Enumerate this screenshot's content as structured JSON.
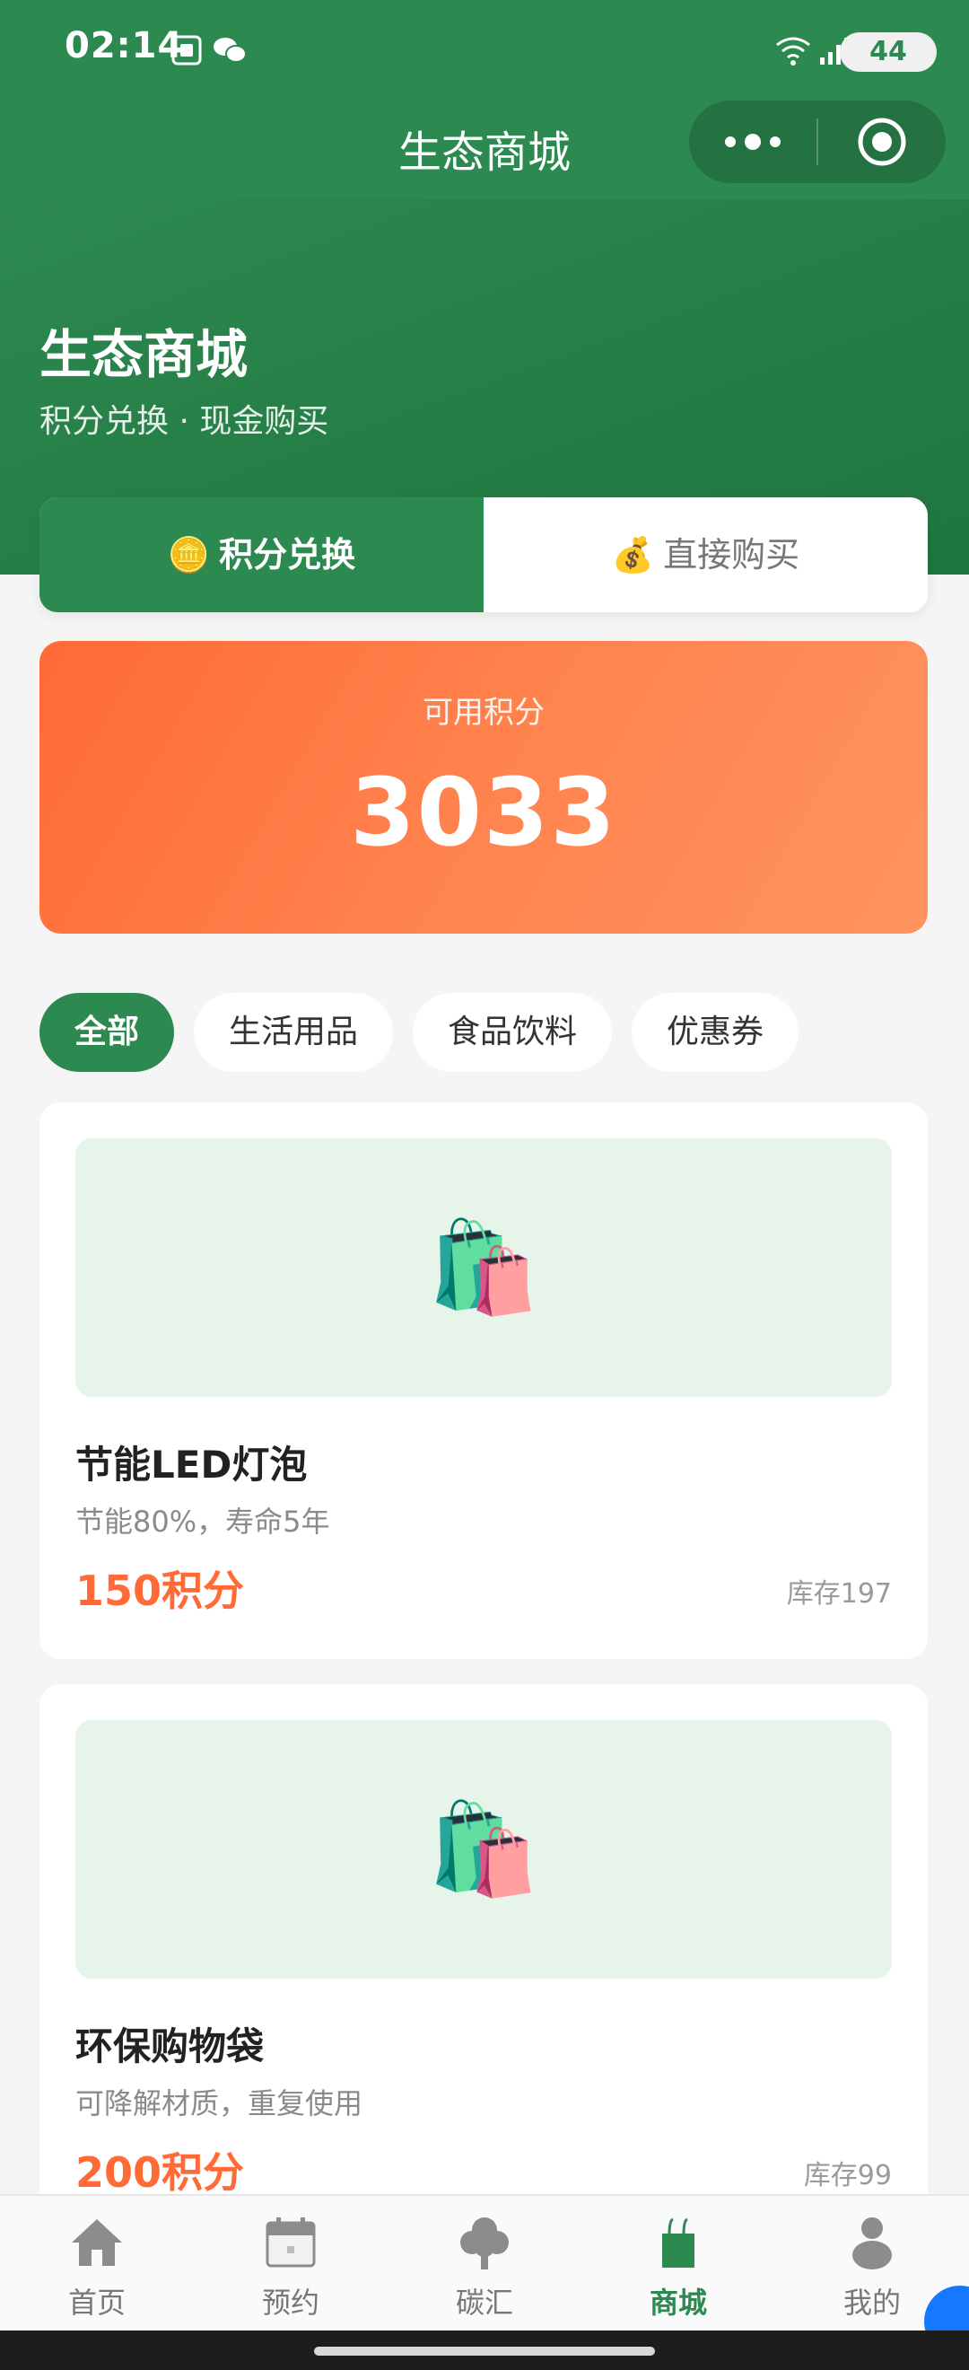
{
  "status_bar": {
    "time": "02:14",
    "battery": "44"
  },
  "nav": {
    "title": "生态商城",
    "capsule_icons": [
      "more-icon",
      "target-icon"
    ]
  },
  "hero": {
    "title": "生态商城",
    "subtitle": "积分兑换 · 现金购买"
  },
  "tabs": [
    {
      "emoji": "🪙",
      "label": "积分兑换",
      "active": true
    },
    {
      "emoji": "💰",
      "label": "直接购买",
      "active": false
    }
  ],
  "points": {
    "label": "可用积分",
    "value": "3033"
  },
  "categories": [
    {
      "label": "全部",
      "active": true
    },
    {
      "label": "生活用品",
      "active": false
    },
    {
      "label": "食品饮料",
      "active": false
    },
    {
      "label": "优惠券",
      "active": false
    }
  ],
  "products": [
    {
      "image_emoji": "🛍️",
      "name": "节能LED灯泡",
      "desc": "节能80%，寿命5年",
      "price": "150积分",
      "stock": "库存197"
    },
    {
      "image_emoji": "🛍️",
      "name": "环保购物袋",
      "desc": "可降解材质，重复使用",
      "price": "200积分",
      "stock": "库存99"
    }
  ],
  "tabbar": [
    {
      "label": "首页",
      "icon": "home-icon",
      "active": false
    },
    {
      "label": "预约",
      "icon": "calendar-icon",
      "active": false
    },
    {
      "label": "碳汇",
      "icon": "tree-icon",
      "active": false
    },
    {
      "label": "商城",
      "icon": "shop-bag-icon",
      "active": true
    },
    {
      "label": "我的",
      "icon": "user-icon",
      "active": false
    }
  ],
  "colors": {
    "brand_green": "#2c8a50",
    "accent_orange": "#ff6a36",
    "image_bg": "#e6f4ea"
  }
}
